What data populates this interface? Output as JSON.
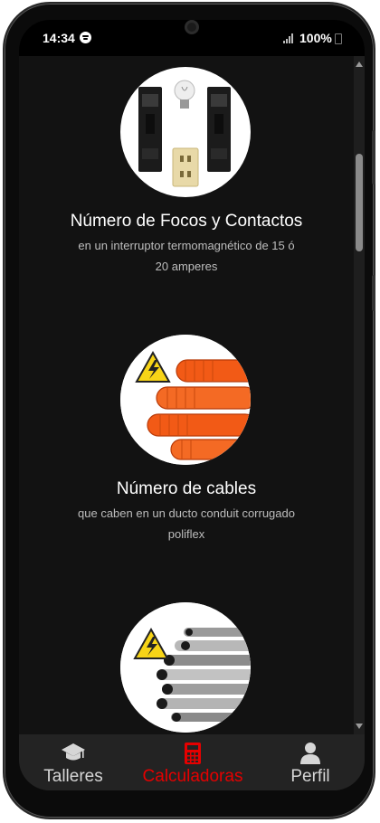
{
  "status_bar": {
    "time": "14:34",
    "battery": "100%"
  },
  "cards": [
    {
      "title": "Número de Focos y Contactos",
      "subtitle_line1": "en un interruptor termomagnético de 15 ó",
      "subtitle_line2": "20 amperes",
      "image": "breaker-bulb-outlet"
    },
    {
      "title": "Número de cables",
      "subtitle_line1": "que caben en un ducto conduit corrugado",
      "subtitle_line2": "poliflex",
      "image": "orange-conduit-warning"
    },
    {
      "title": "",
      "image": "steel-pipes-warning"
    }
  ],
  "bottom_nav": {
    "items": [
      {
        "label": "Talleres",
        "icon": "graduation-cap-icon",
        "active": false
      },
      {
        "label": "Calculadoras",
        "icon": "calculator-icon",
        "active": true
      },
      {
        "label": "Perfil",
        "icon": "user-icon",
        "active": false
      }
    ]
  },
  "colors": {
    "background": "#121212",
    "nav_background": "#232323",
    "active": "#e60000",
    "inactive": "#d6d6d6",
    "conduit_orange": "#f25a16",
    "warning_yellow": "#f7d417"
  }
}
